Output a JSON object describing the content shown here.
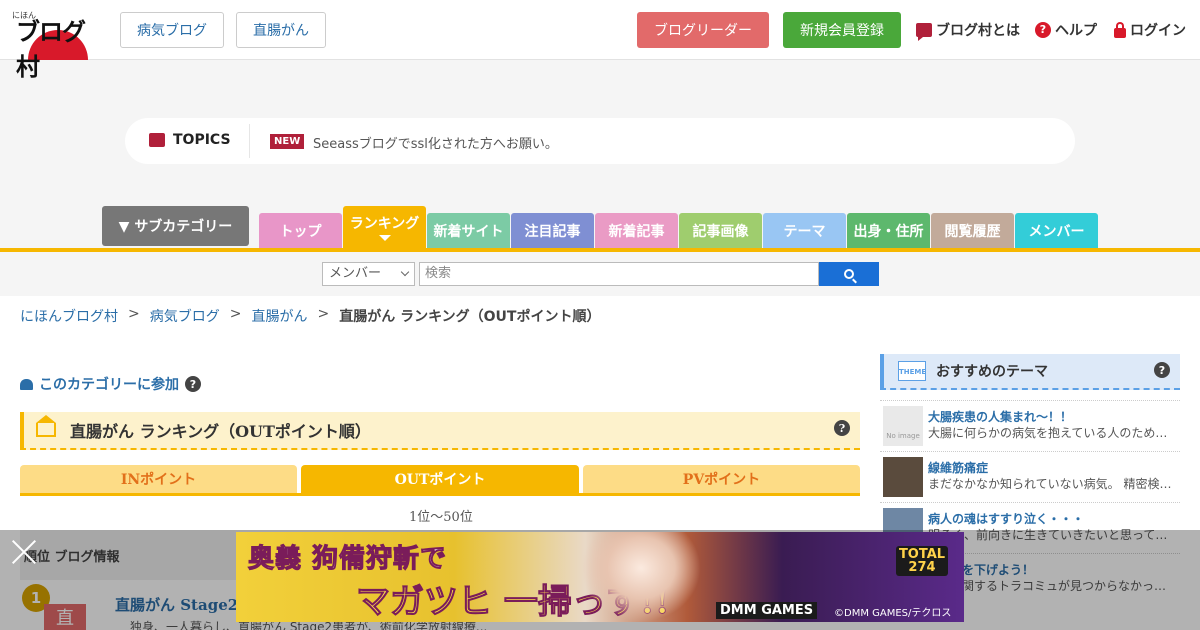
{
  "header": {
    "logo_small": "にほん",
    "logo_text": "ブログ村",
    "nav1": "病気ブログ",
    "nav2": "直腸がん",
    "reader": "ブログリーダー",
    "register": "新規会員登録",
    "about": "ブログ村とは",
    "help": "ヘルプ",
    "login": "ログイン"
  },
  "topics": {
    "label": "TOPICS",
    "badge": "NEW",
    "text": "Seeassブログでssl化された方へお願い。"
  },
  "tabs": {
    "subcat": "▼ サブカテゴリー",
    "items": [
      "トップ",
      "ランキング",
      "新着サイト",
      "注目記事",
      "新着記事",
      "記事画像",
      "テーマ",
      "出身・住所",
      "閲覧履歴",
      "メンバー"
    ],
    "colors": [
      "#e896c8",
      "#f6b700",
      "#7ccba5",
      "#7f8fd3",
      "#ea9bc5",
      "#9fcd6e",
      "#99c6f3",
      "#5db86d",
      "#c2aa9a",
      "#33cdd8"
    ]
  },
  "search": {
    "select_value": "メンバー",
    "placeholder": "検索"
  },
  "breadcrumb": {
    "c1": "にほんブログ村",
    "c2": "病気ブログ",
    "c3": "直腸がん",
    "current": "直腸がん ランキング（OUTポイント順）",
    "sep": ">"
  },
  "join": "このカテゴリーに参加",
  "ranking": {
    "title": "直腸がん ランキング（OUTポイント順）",
    "tab_in": "INポイント",
    "tab_out": "OUTポイント",
    "tab_pv": "PVポイント",
    "range": "1位〜50位",
    "list_head": "順位  ブログ情報",
    "entry_rank": "1",
    "entry_cat": "直",
    "entry_title": "直腸がん Stage2患",
    "entry_desc": "独身、一人暮らし、直腸がん Stage2患者が、術前化学放射線療..."
  },
  "sidebar": {
    "head": "おすすめのテーマ",
    "badge": "THEME",
    "noimg": "No image",
    "items": [
      {
        "title": "大腸疾患の人集まれ〜！！",
        "desc": "大腸に何らかの病気を抱えている人のため…"
      },
      {
        "title": "線維筋痛症",
        "desc": "まだなかなか知られていない病気。 精密検…"
      },
      {
        "title": "病人の魂はすすり泣く・・・",
        "desc": "明るく、前向きに生きていきたいと思って…"
      },
      {
        "title": "を下げよう！",
        "desc": "関するトラコミュが見つからなかっ…"
      }
    ]
  },
  "ad": {
    "line1": "奥義 狗備狩斬で",
    "line2": "マガツヒ 一掃っす!!",
    "total_label": "TOTAL",
    "total_value": "274",
    "brand": "DMM GAMES",
    "copyright": "©DMM GAMES/テクロス"
  }
}
